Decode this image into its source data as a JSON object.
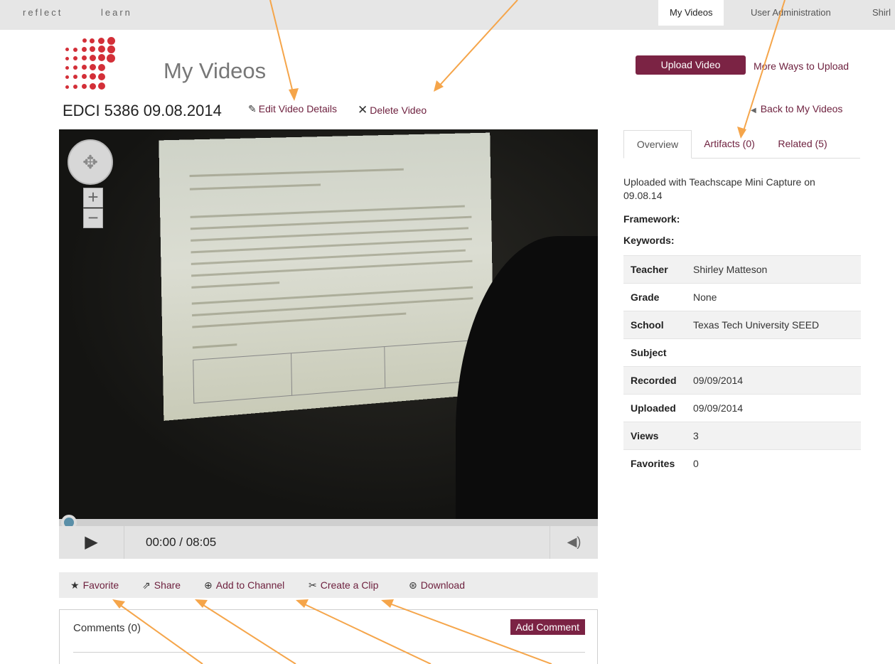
{
  "topbar": {
    "brand_left": "reflect",
    "brand_right": "learn",
    "nav": {
      "my_videos": "My Videos",
      "user_admin": "User Administration",
      "user": "Shirl"
    }
  },
  "header": {
    "title": "My Videos",
    "upload_button": "Upload Video",
    "more_ways": "More Ways to Upload",
    "back_link": "Back to My Videos"
  },
  "video": {
    "title": "EDCI 5386 09.08.2014",
    "edit_label": "Edit Video Details",
    "delete_label": "Delete Video",
    "time_display": "00:00 / 08:05",
    "progress": 0
  },
  "actions": {
    "favorite": "Favorite",
    "share": "Share",
    "add_to_channel": "Add to Channel",
    "create_clip": "Create a Clip",
    "download": "Download"
  },
  "comments": {
    "label": "Comments (0)",
    "add_button": "Add Comment"
  },
  "tabs": [
    {
      "label": "Overview",
      "active": true
    },
    {
      "label": "Artifacts (0)",
      "active": false
    },
    {
      "label": "Related (5)",
      "active": false
    }
  ],
  "overview": {
    "upload_info": "Uploaded with Teachscape Mini Capture on 09.08.14",
    "framework_label": "Framework:",
    "keywords_label": "Keywords:",
    "details": [
      {
        "key": "Teacher",
        "value": "Shirley Matteson"
      },
      {
        "key": "Grade",
        "value": "None"
      },
      {
        "key": "School",
        "value": "Texas Tech University SEED"
      },
      {
        "key": "Subject",
        "value": ""
      },
      {
        "key": "Recorded",
        "value": "09/09/2014"
      },
      {
        "key": "Uploaded",
        "value": "09/09/2014"
      },
      {
        "key": "Views",
        "value": "3"
      },
      {
        "key": "Favorites",
        "value": "0"
      }
    ]
  },
  "icons": {
    "edit": "edit-icon",
    "delete": "close-icon",
    "favorite": "star-icon",
    "share": "share-icon",
    "add": "plus-circle-icon",
    "clip": "scissors-icon",
    "download": "download-icon",
    "play": "play-icon",
    "volume": "volume-icon"
  },
  "colors": {
    "accent": "#7b2344",
    "link": "#6d1f3d",
    "logo": "#d32f38",
    "annotation": "#f5a54a"
  }
}
